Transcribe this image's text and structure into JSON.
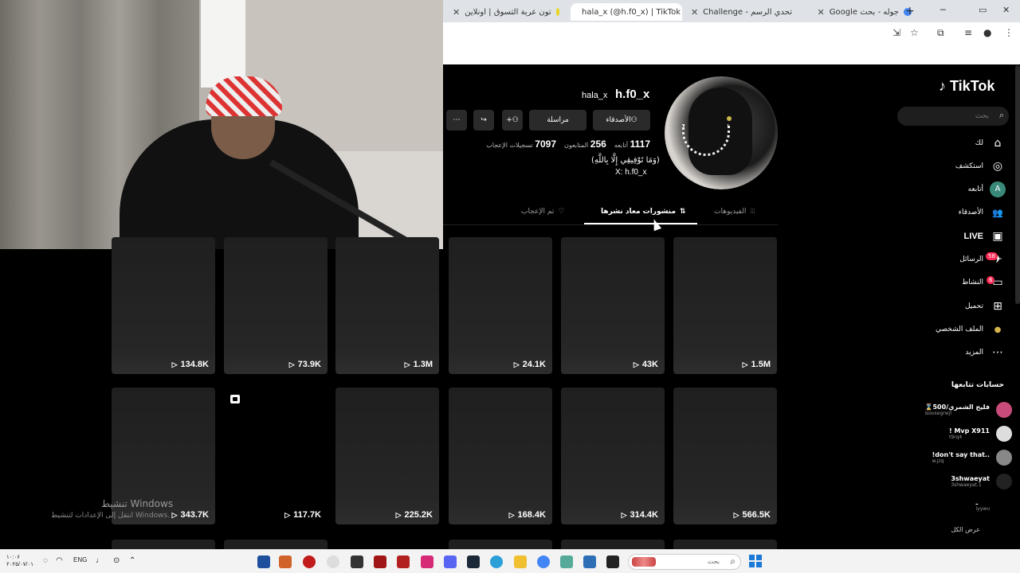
{
  "browser": {
    "tabs": [
      {
        "title": "جوله - بحث Google",
        "active": false
      },
      {
        "title": "تحدي الرسم - Challenge",
        "active": false
      },
      {
        "title": "hala_x (@h.f0_x) | TikTok",
        "active": true
      },
      {
        "title": "تون عربة التسوق | اونلاين",
        "active": false
      }
    ],
    "new_tab": "+",
    "close_glyph": "✕"
  },
  "tiktok": {
    "logo": "TikTok",
    "search_placeholder": "بحث",
    "nav": [
      {
        "label": "لك",
        "icon": "home-icon",
        "glyph": "⌂"
      },
      {
        "label": "استكشف",
        "icon": "compass-icon",
        "glyph": "◎"
      },
      {
        "label": "أتابعه",
        "icon": "following-avatar-icon",
        "glyph": "A"
      },
      {
        "label": "الأصدقاء",
        "icon": "friends-icon",
        "glyph": "👥"
      },
      {
        "label": "LIVE",
        "icon": "live-icon",
        "glyph": "▣"
      },
      {
        "label": "الرسائل",
        "icon": "messages-icon",
        "glyph": "✈",
        "badge": "58"
      },
      {
        "label": "النشاط",
        "icon": "activity-icon",
        "glyph": "▭",
        "badge": "6"
      },
      {
        "label": "تحميل",
        "icon": "upload-icon",
        "glyph": "⊞"
      },
      {
        "label": "الملف الشخصي",
        "icon": "profile-icon",
        "glyph": "●"
      },
      {
        "label": "المزيد",
        "icon": "more-icon",
        "glyph": "⋯"
      }
    ],
    "following_heading": "حسابات تتابعها",
    "following": [
      {
        "name": "فليح الشمري/500⌛",
        "user": "isoosegrwjl",
        "color": "#c94b7a"
      },
      {
        "name": "Mvp X911 !",
        "user": "t9rq4",
        "color": "#dddddd"
      },
      {
        "name": "..don't say that!",
        "user": "w.jzq",
        "color": "#888888"
      },
      {
        "name": "3shwaeyat",
        "user": "3shwaeyat.1",
        "color": "#222222"
      },
      {
        "name": "ـ",
        "user": "iyywu",
        "color": "#000000"
      }
    ],
    "see_all": "عرض الكل"
  },
  "profile": {
    "username": "h.f0_x",
    "nickname": "hala_x",
    "buttons": {
      "friends": "الأصدقاء",
      "message": "مراسلة"
    },
    "stats": [
      {
        "value": "1117",
        "label": "أتابعه"
      },
      {
        "value": "256",
        "label": "المتابعون"
      },
      {
        "value": "7097",
        "label": "تسجيلات الإعجاب"
      }
    ],
    "bio_line1": "(وَمَا تَوْفِيقِي إِلَّا بِاللَّهِ)",
    "bio_line2": "X: h.f0_x",
    "tabs": [
      {
        "label": "الفيديوهات",
        "glyph": "⦙⦙⦙",
        "active": false
      },
      {
        "label": "منشورات معاد نشرها",
        "glyph": "⇅",
        "active": true
      },
      {
        "label": "تم الإعجاب",
        "glyph": "♡",
        "active": false
      }
    ]
  },
  "videos_row1": [
    "1.5M",
    "43K",
    "24.1K",
    "1.3M",
    "73.9K",
    "134.8K"
  ],
  "videos_row2": [
    "566.5K",
    "314.4K",
    "168.4K",
    "225.2K",
    "117.7K",
    "343.7K"
  ],
  "watermark": {
    "line1": "تنشيط Windows",
    "line2": "انتقل إلى الإعدادات لتنشيط Windows."
  },
  "taskbar": {
    "search_placeholder": "بحث",
    "lang": "ENG",
    "clock_time": "۱۰:۰۶",
    "clock_date": "۲۰۲۵/۰۷/۰۱"
  }
}
